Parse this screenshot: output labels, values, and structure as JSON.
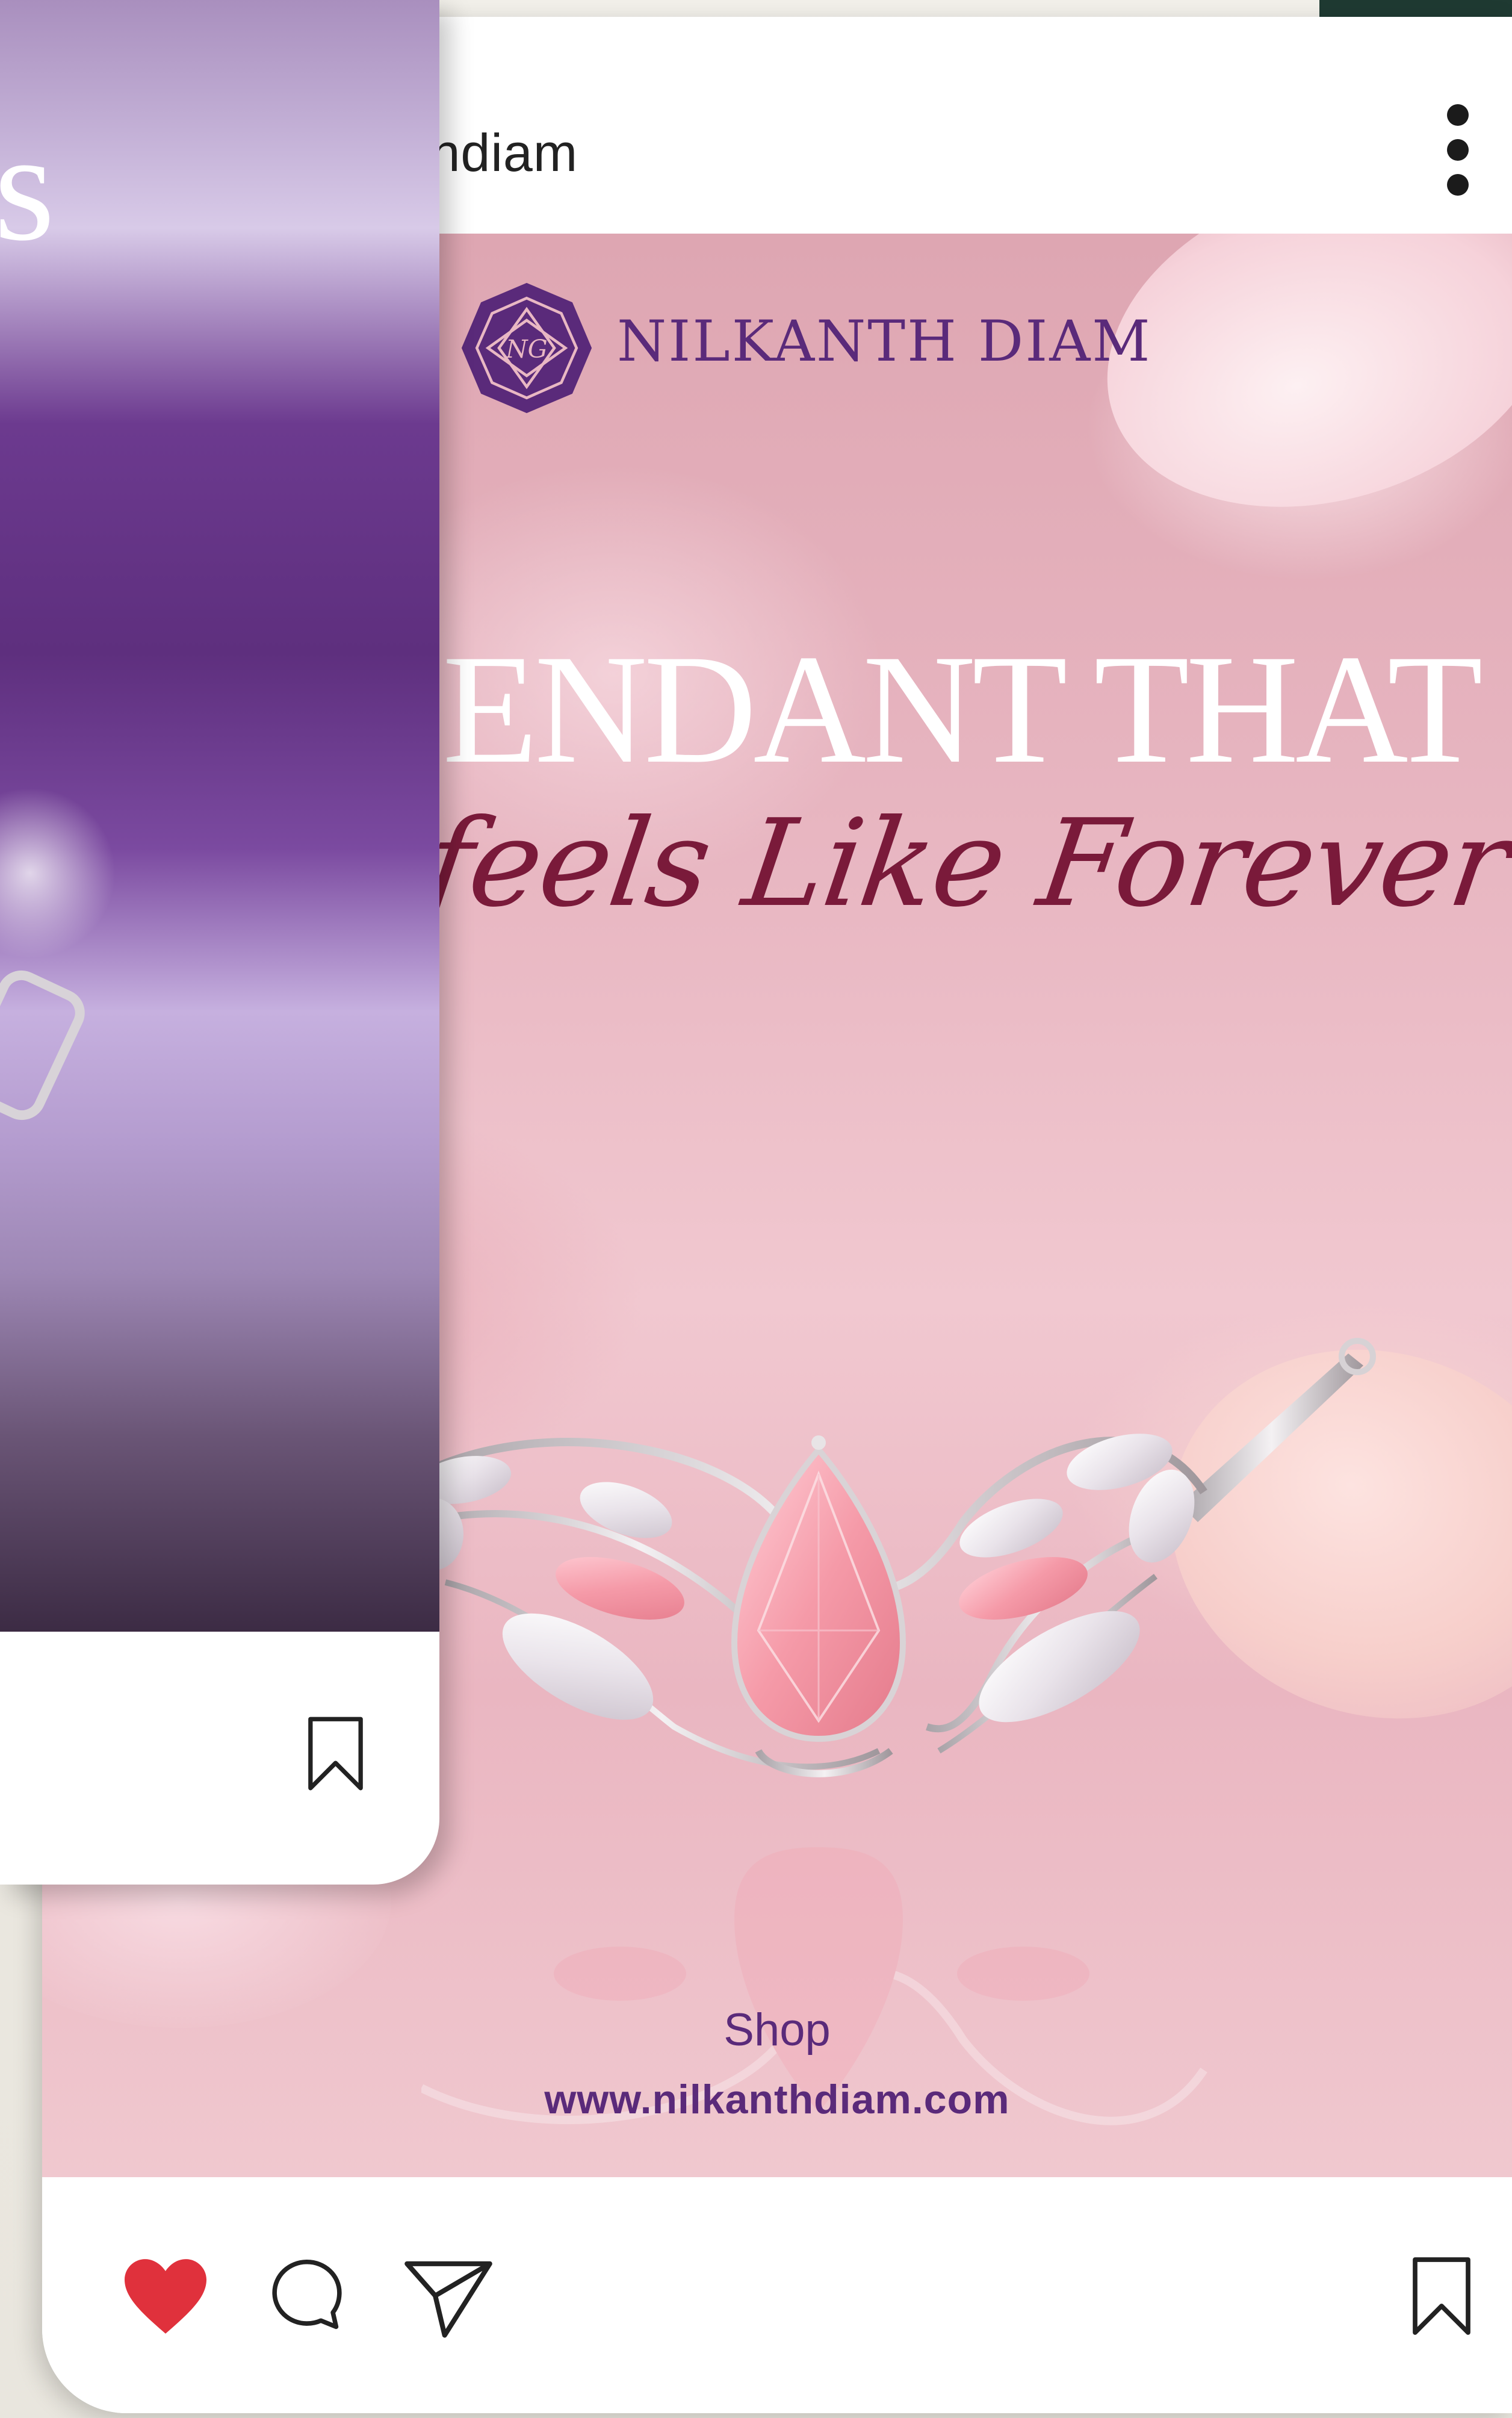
{
  "left_post": {
    "title_fragment": "s",
    "bookmark_icon": "bookmark-outline-icon"
  },
  "post": {
    "username_fragment": "thdiam",
    "more_icon": "more-vertical-icon",
    "image": {
      "brand_name": "NILKANTH DIAM",
      "logo_monogram": "NG",
      "headline": "ENDANT THAT",
      "tagline": "feels Like Forever",
      "cta": "Shop",
      "website": "www.nilkanthdiam.com"
    },
    "actions": {
      "like_icon": "heart-filled-icon",
      "comment_icon": "comment-icon",
      "share_icon": "send-icon",
      "save_icon": "bookmark-outline-icon",
      "liked": true,
      "like_color": "#e0313c"
    }
  },
  "colors": {
    "brand_purple": "#5a2a7a",
    "tagline_burgundy": "#7a1a3a",
    "like_red": "#e0313c"
  }
}
